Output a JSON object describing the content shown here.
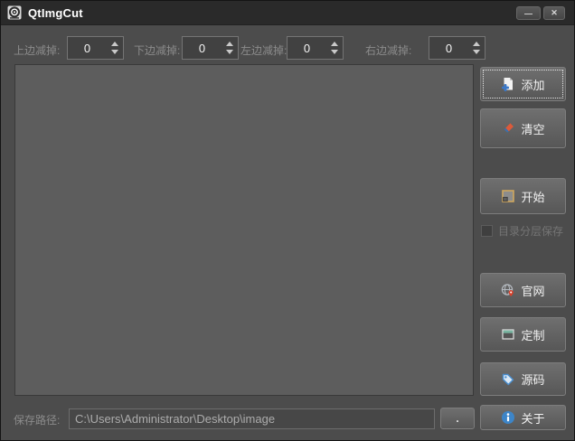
{
  "window": {
    "title": "QtImgCut"
  },
  "titlebar": {
    "minimize_glyph": "—",
    "close_glyph": "✕"
  },
  "crop_controls": [
    {
      "label": "上边减掉:",
      "value": "0"
    },
    {
      "label": "下边减掉:",
      "value": "0"
    },
    {
      "label": "左边减掉:",
      "value": "0"
    },
    {
      "label": "右边减掉:",
      "value": "0"
    }
  ],
  "sidebar": {
    "add": "添加",
    "clear": "清空",
    "start": "开始",
    "layered_save": "目录分层保存",
    "website": "官网",
    "custom": "定制",
    "source": "源码",
    "about": "关于"
  },
  "footer": {
    "save_path_label": "保存路径:",
    "save_path_value": "C:\\Users\\Administrator\\Desktop\\image",
    "browse": "."
  },
  "colors": {
    "accent_blue": "#3d85c8",
    "eraser_red": "#dd5a3a",
    "eraser_blue": "#3e6fa8",
    "pin_red": "#d9402a",
    "start_border": "#cfa75e",
    "window_teal": "#79b5a1"
  }
}
